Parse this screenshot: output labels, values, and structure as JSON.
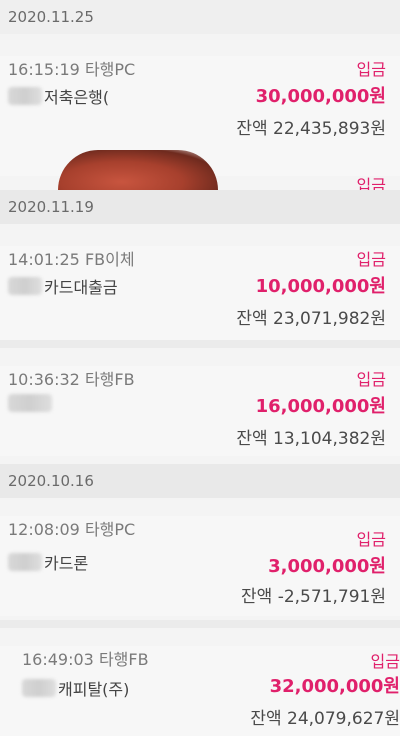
{
  "groups": [
    {
      "date": "2020.11.25",
      "transactions": [
        {
          "time": "16:15:19 타행PC",
          "name": "저축은행(",
          "type": "입금",
          "amount": "30,000,000원",
          "balance": "잔액 22,435,893원"
        }
      ]
    },
    {
      "date": "2020.11.19",
      "transactions": [
        {
          "time": "14:01:25 FB이체",
          "name": "카드대출금",
          "type": "입금",
          "amount": "10,000,000원",
          "balance": "잔액 23,071,982원"
        },
        {
          "time": "10:36:32 타행FB",
          "name": "",
          "type": "입금",
          "amount": "16,000,000원",
          "balance": "잔액 13,104,382원"
        }
      ]
    },
    {
      "date": "2020.10.16",
      "transactions": [
        {
          "time": "12:08:09 타행PC",
          "name": "카드론",
          "type": "입금",
          "amount": "3,000,000원",
          "balance": "잔액 -2,571,791원"
        },
        {
          "time": "16:49:03 타행FB",
          "name": "캐피탈(주)",
          "type": "입금",
          "amount": "32,000,000원",
          "balance": "잔액 24,079,627원"
        }
      ]
    }
  ],
  "partial_row": {
    "time": "",
    "type": "입금"
  }
}
